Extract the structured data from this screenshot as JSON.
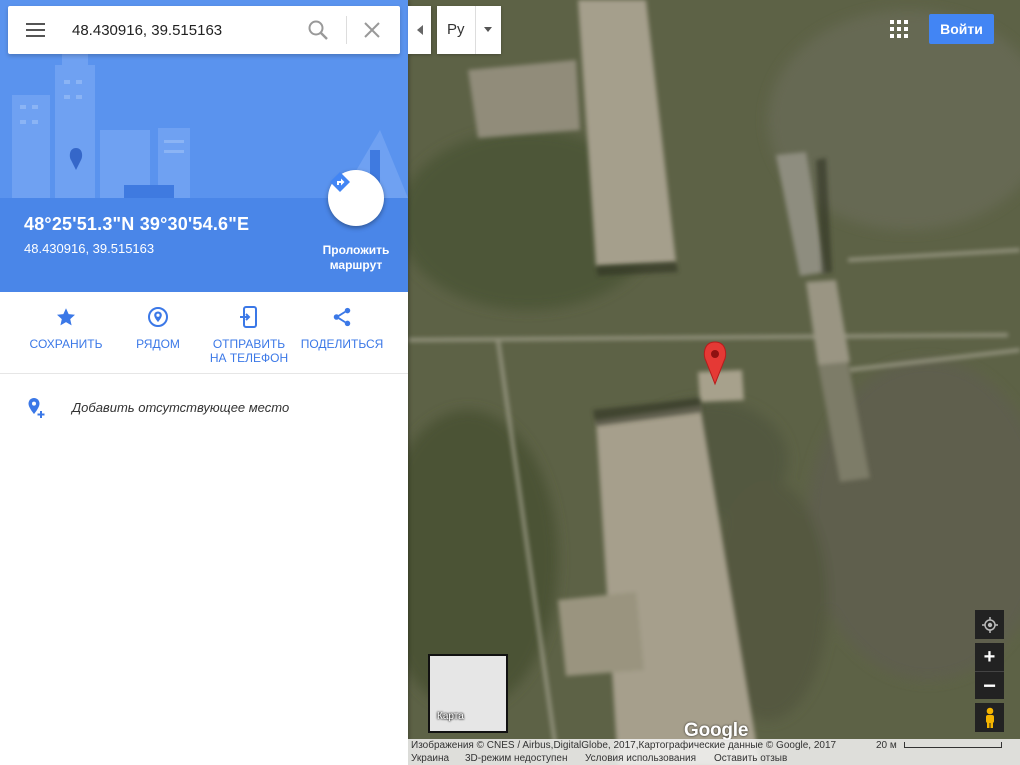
{
  "search": {
    "value": "48.430916, 39.515163"
  },
  "place": {
    "coords_dms": "48°25'51.3\"N 39°30'54.6\"E",
    "coords_decimal": "48.430916, 39.515163",
    "directions_label": "Проложить маршрут"
  },
  "actions": [
    {
      "label": "СОХРАНИТЬ",
      "icon": "star-icon"
    },
    {
      "label": "РЯДОМ",
      "icon": "nearby-pin-icon"
    },
    {
      "label": "ОТПРАВИТЬ\nНА ТЕЛЕФОН",
      "icon": "send-to-phone-icon"
    },
    {
      "label": "ПОДЕЛИТЬСЯ",
      "icon": "share-icon"
    }
  ],
  "add_place": {
    "label": "Добавить отсутствующее место"
  },
  "language": {
    "value": "Ру"
  },
  "header": {
    "signin_label": "Войти"
  },
  "controls": {
    "zoom_in": "+",
    "zoom_out": "−"
  },
  "minimap": {
    "label": "Карта"
  },
  "map": {
    "logo": "Google"
  },
  "footer": {
    "attribution": "Изображения © CNES / Airbus,DigitalGlobe, 2017,Картографические данные © Google, 2017",
    "scale": "20 м",
    "links": [
      "Украина",
      "3D-режим недоступен",
      "Условия использования",
      "Оставить отзыв"
    ]
  },
  "colors": {
    "accent": "#4285f4",
    "hero": "#4a86e8",
    "marker": "#e53935"
  }
}
